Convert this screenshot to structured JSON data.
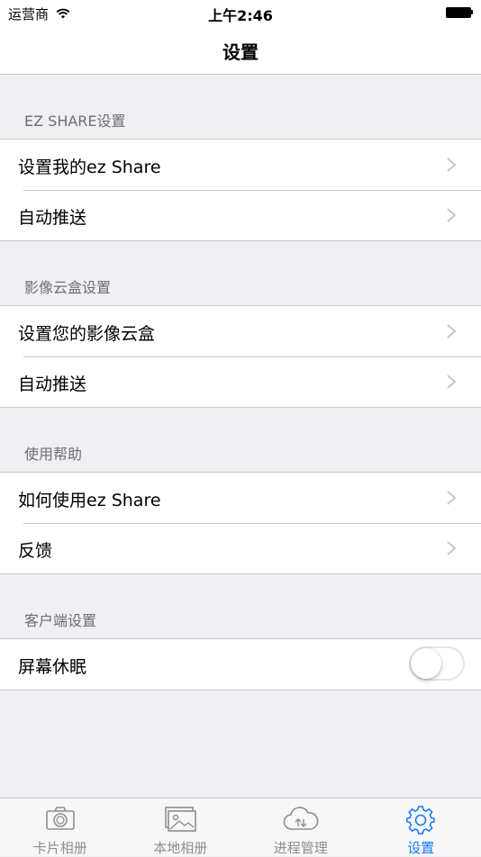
{
  "status_bar": {
    "carrier": "运营商",
    "time": "上午2:46"
  },
  "nav": {
    "title": "设置"
  },
  "sections": [
    {
      "header": "EZ SHARE设置",
      "rows": [
        {
          "label": "设置我的ez Share"
        },
        {
          "label": "自动推送"
        }
      ]
    },
    {
      "header": "影像云盒设置",
      "rows": [
        {
          "label": "设置您的影像云盒"
        },
        {
          "label": "自动推送"
        }
      ]
    },
    {
      "header": "使用帮助",
      "rows": [
        {
          "label": "如何使用ez Share"
        },
        {
          "label": "反馈"
        }
      ]
    },
    {
      "header": "客户端设置",
      "rows": [
        {
          "label": "屏幕休眠",
          "toggle_on": false
        }
      ]
    }
  ],
  "tabbar": {
    "items": [
      {
        "label": "卡片相册",
        "icon": "camera-icon",
        "active": false
      },
      {
        "label": "本地相册",
        "icon": "photos-icon",
        "active": false
      },
      {
        "label": "进程管理",
        "icon": "cloud-transfer-icon",
        "active": false
      },
      {
        "label": "设置",
        "icon": "gear-icon",
        "active": true
      }
    ]
  },
  "colors": {
    "accent": "#1678fa",
    "inactive": "#8e8e93",
    "background": "#efeff4"
  }
}
